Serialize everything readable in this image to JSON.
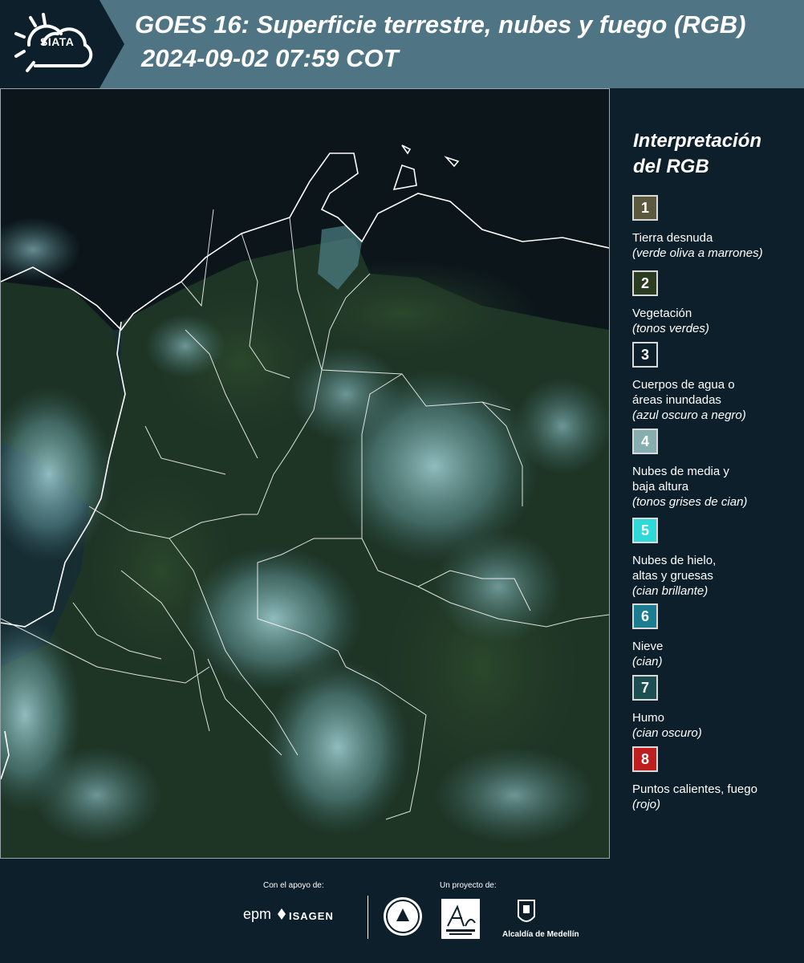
{
  "header": {
    "logo_text": "SIATA",
    "title": "GOES 16: Superficie terrestre, nubes y fuego (RGB)",
    "subtitle": "2024-09-02 07:59 COT"
  },
  "legend": {
    "title_line1": "Interpretación",
    "title_line2": "del RGB",
    "items": [
      {
        "number": "1",
        "color": "#5b5a3e",
        "label": "Tierra desnuda",
        "note": "(verde oliva a marrones)"
      },
      {
        "number": "2",
        "color": "#2b3d21",
        "label": "Vegetación",
        "note": "(tonos verdes)"
      },
      {
        "number": "3",
        "color": "#0c1f2b",
        "label": "Cuerpos de agua o áreas inundadas",
        "note": "(azul oscuro a negro)"
      },
      {
        "number": "4",
        "color": "#87aeaf",
        "label": "Nubes de media y baja altura",
        "note": "(tonos grises de cian)"
      },
      {
        "number": "5",
        "color": "#2ed9d9",
        "label": "Nubes de hielo, altas y gruesas",
        "note": "(cian brillante)"
      },
      {
        "number": "6",
        "color": "#1c7d91",
        "label": "Nieve",
        "note": "(cian)"
      },
      {
        "number": "7",
        "color": "#1d4f52",
        "label": "Humo",
        "note": "(cian oscuro)"
      },
      {
        "number": "8",
        "color": "#be1e1e",
        "label": "Puntos calientes, fuego",
        "note": "(rojo)"
      }
    ]
  },
  "footer": {
    "support_label": "Con el apoyo de:",
    "project_label": "Un proyecto de:",
    "epm_text": "epm",
    "isagen_text": "ISAGEN",
    "alcaldia_text": "Alcaldía de Medellín"
  }
}
